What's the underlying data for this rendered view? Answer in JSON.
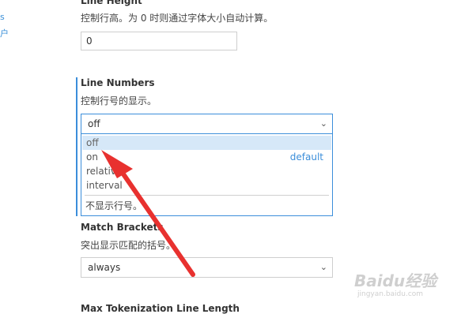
{
  "left_links": [
    "s",
    "户"
  ],
  "line_height": {
    "title": "Line Height",
    "description": "控制行高。为 0 时则通过字体大小自动计算。",
    "value": "0"
  },
  "line_numbers": {
    "title": "Line Numbers",
    "description": "控制行号的显示。",
    "selected": "off",
    "options": [
      {
        "label": "off",
        "note": ""
      },
      {
        "label": "on",
        "note": "default"
      },
      {
        "label": "relative",
        "note": ""
      },
      {
        "label": "interval",
        "note": ""
      }
    ],
    "option_description": "不显示行号。"
  },
  "match_brackets": {
    "title": "Match Brackets",
    "description": "突出显示匹配的括号。",
    "selected": "always"
  },
  "max_tokenization": {
    "title": "Max Tokenization Line Length"
  },
  "watermark": {
    "brand": "Baidu经验",
    "url": "jingyan.baidu.com"
  },
  "colors": {
    "accent": "#3b8eda",
    "annotation_arrow": "#e8312f",
    "selected_option_bg": "#d6e8f8"
  }
}
